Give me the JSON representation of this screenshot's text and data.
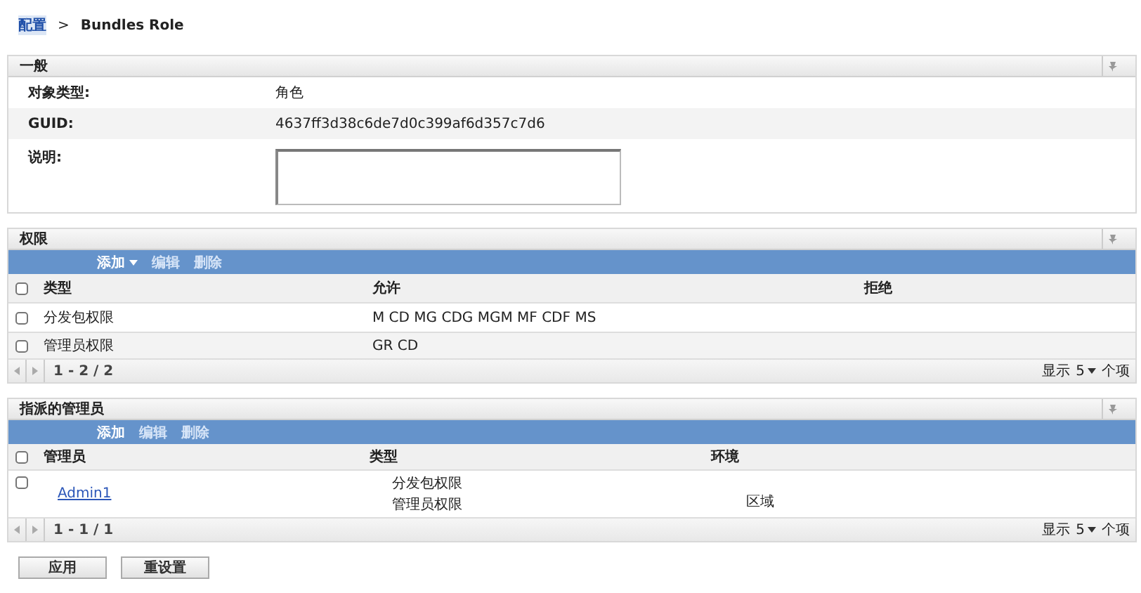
{
  "breadcrumb": {
    "link": "配置",
    "separator": ">",
    "current": "Bundles Role"
  },
  "general": {
    "title": "一般",
    "rows": [
      {
        "label": "对象类型:",
        "value": "角色"
      },
      {
        "label": "GUID:",
        "value": "4637ff3d38c6de7d0c399af6d357c7d6"
      }
    ],
    "description": {
      "label": "说明:"
    }
  },
  "rights": {
    "title": "权限",
    "toolbar": [
      {
        "label": "添加",
        "dropdown": true
      },
      {
        "label": "编辑",
        "dropdown": false
      },
      {
        "label": "删除",
        "dropdown": false
      }
    ],
    "all_checked": false,
    "columns": [
      "类型",
      "允许",
      "拒绝"
    ],
    "rows": [
      {
        "checked": false,
        "type": "分发包权限",
        "allow": "M CD MG CDG MGM MF CDF MS"
      },
      {
        "checked": false,
        "type": "管理员权限",
        "allow": "GR CD"
      }
    ],
    "pager": {
      "range": "1 - 2 / 2",
      "show": "显示",
      "count": "5",
      "items": "个项"
    }
  },
  "admins": {
    "title": "指派的管理员",
    "toolbar": [
      {
        "label": "添加",
        "dropdown": false
      },
      {
        "label": "编辑",
        "dropdown": false
      },
      {
        "label": "删除",
        "dropdown": false
      }
    ],
    "all_checked": false,
    "columns": [
      "管理员",
      "类型",
      "环境"
    ],
    "rows": [
      {
        "checked": false,
        "admin": "Admin1",
        "types": [
          "分发包权限",
          "管理员权限"
        ],
        "context": "区域"
      }
    ],
    "pager": {
      "range": "1 - 1 / 1",
      "show": "显示",
      "count": "5",
      "items": "个项"
    }
  },
  "buttons": [
    "应用",
    "重设置"
  ]
}
